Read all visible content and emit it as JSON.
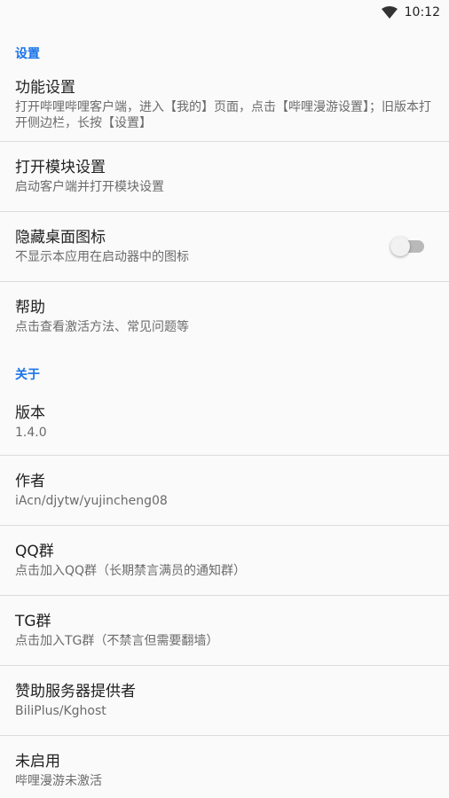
{
  "status_bar": {
    "time": "10:12"
  },
  "sections": [
    {
      "header": "设置",
      "items": [
        {
          "title": "功能设置",
          "summary": "打开哔哩哔哩客户端，进入【我的】页面，点击【哔哩漫游设置】；旧版本打开侧边栏，长按【设置】"
        },
        {
          "title": "打开模块设置",
          "summary": "启动客户端并打开模块设置"
        },
        {
          "title": "隐藏桌面图标",
          "summary": "不显示本应用在启动器中的图标",
          "toggle_on": false
        },
        {
          "title": "帮助",
          "summary": "点击查看激活方法、常见问题等"
        }
      ]
    },
    {
      "header": "关于",
      "items": [
        {
          "title": "版本",
          "summary": "1.4.0"
        },
        {
          "title": "作者",
          "summary": "iAcn/djytw/yujincheng08"
        },
        {
          "title": "QQ群",
          "summary": "点击加入QQ群（长期禁言满员的通知群）"
        },
        {
          "title": "TG群",
          "summary": "点击加入TG群（不禁言但需要翻墙）"
        },
        {
          "title": "赞助服务器提供者",
          "summary": "BiliPlus/Kghost"
        },
        {
          "title": "未启用",
          "summary": "哔哩漫游未激活"
        }
      ]
    }
  ],
  "colors": {
    "accent": "#1a73e8",
    "background": "#fafafa"
  }
}
